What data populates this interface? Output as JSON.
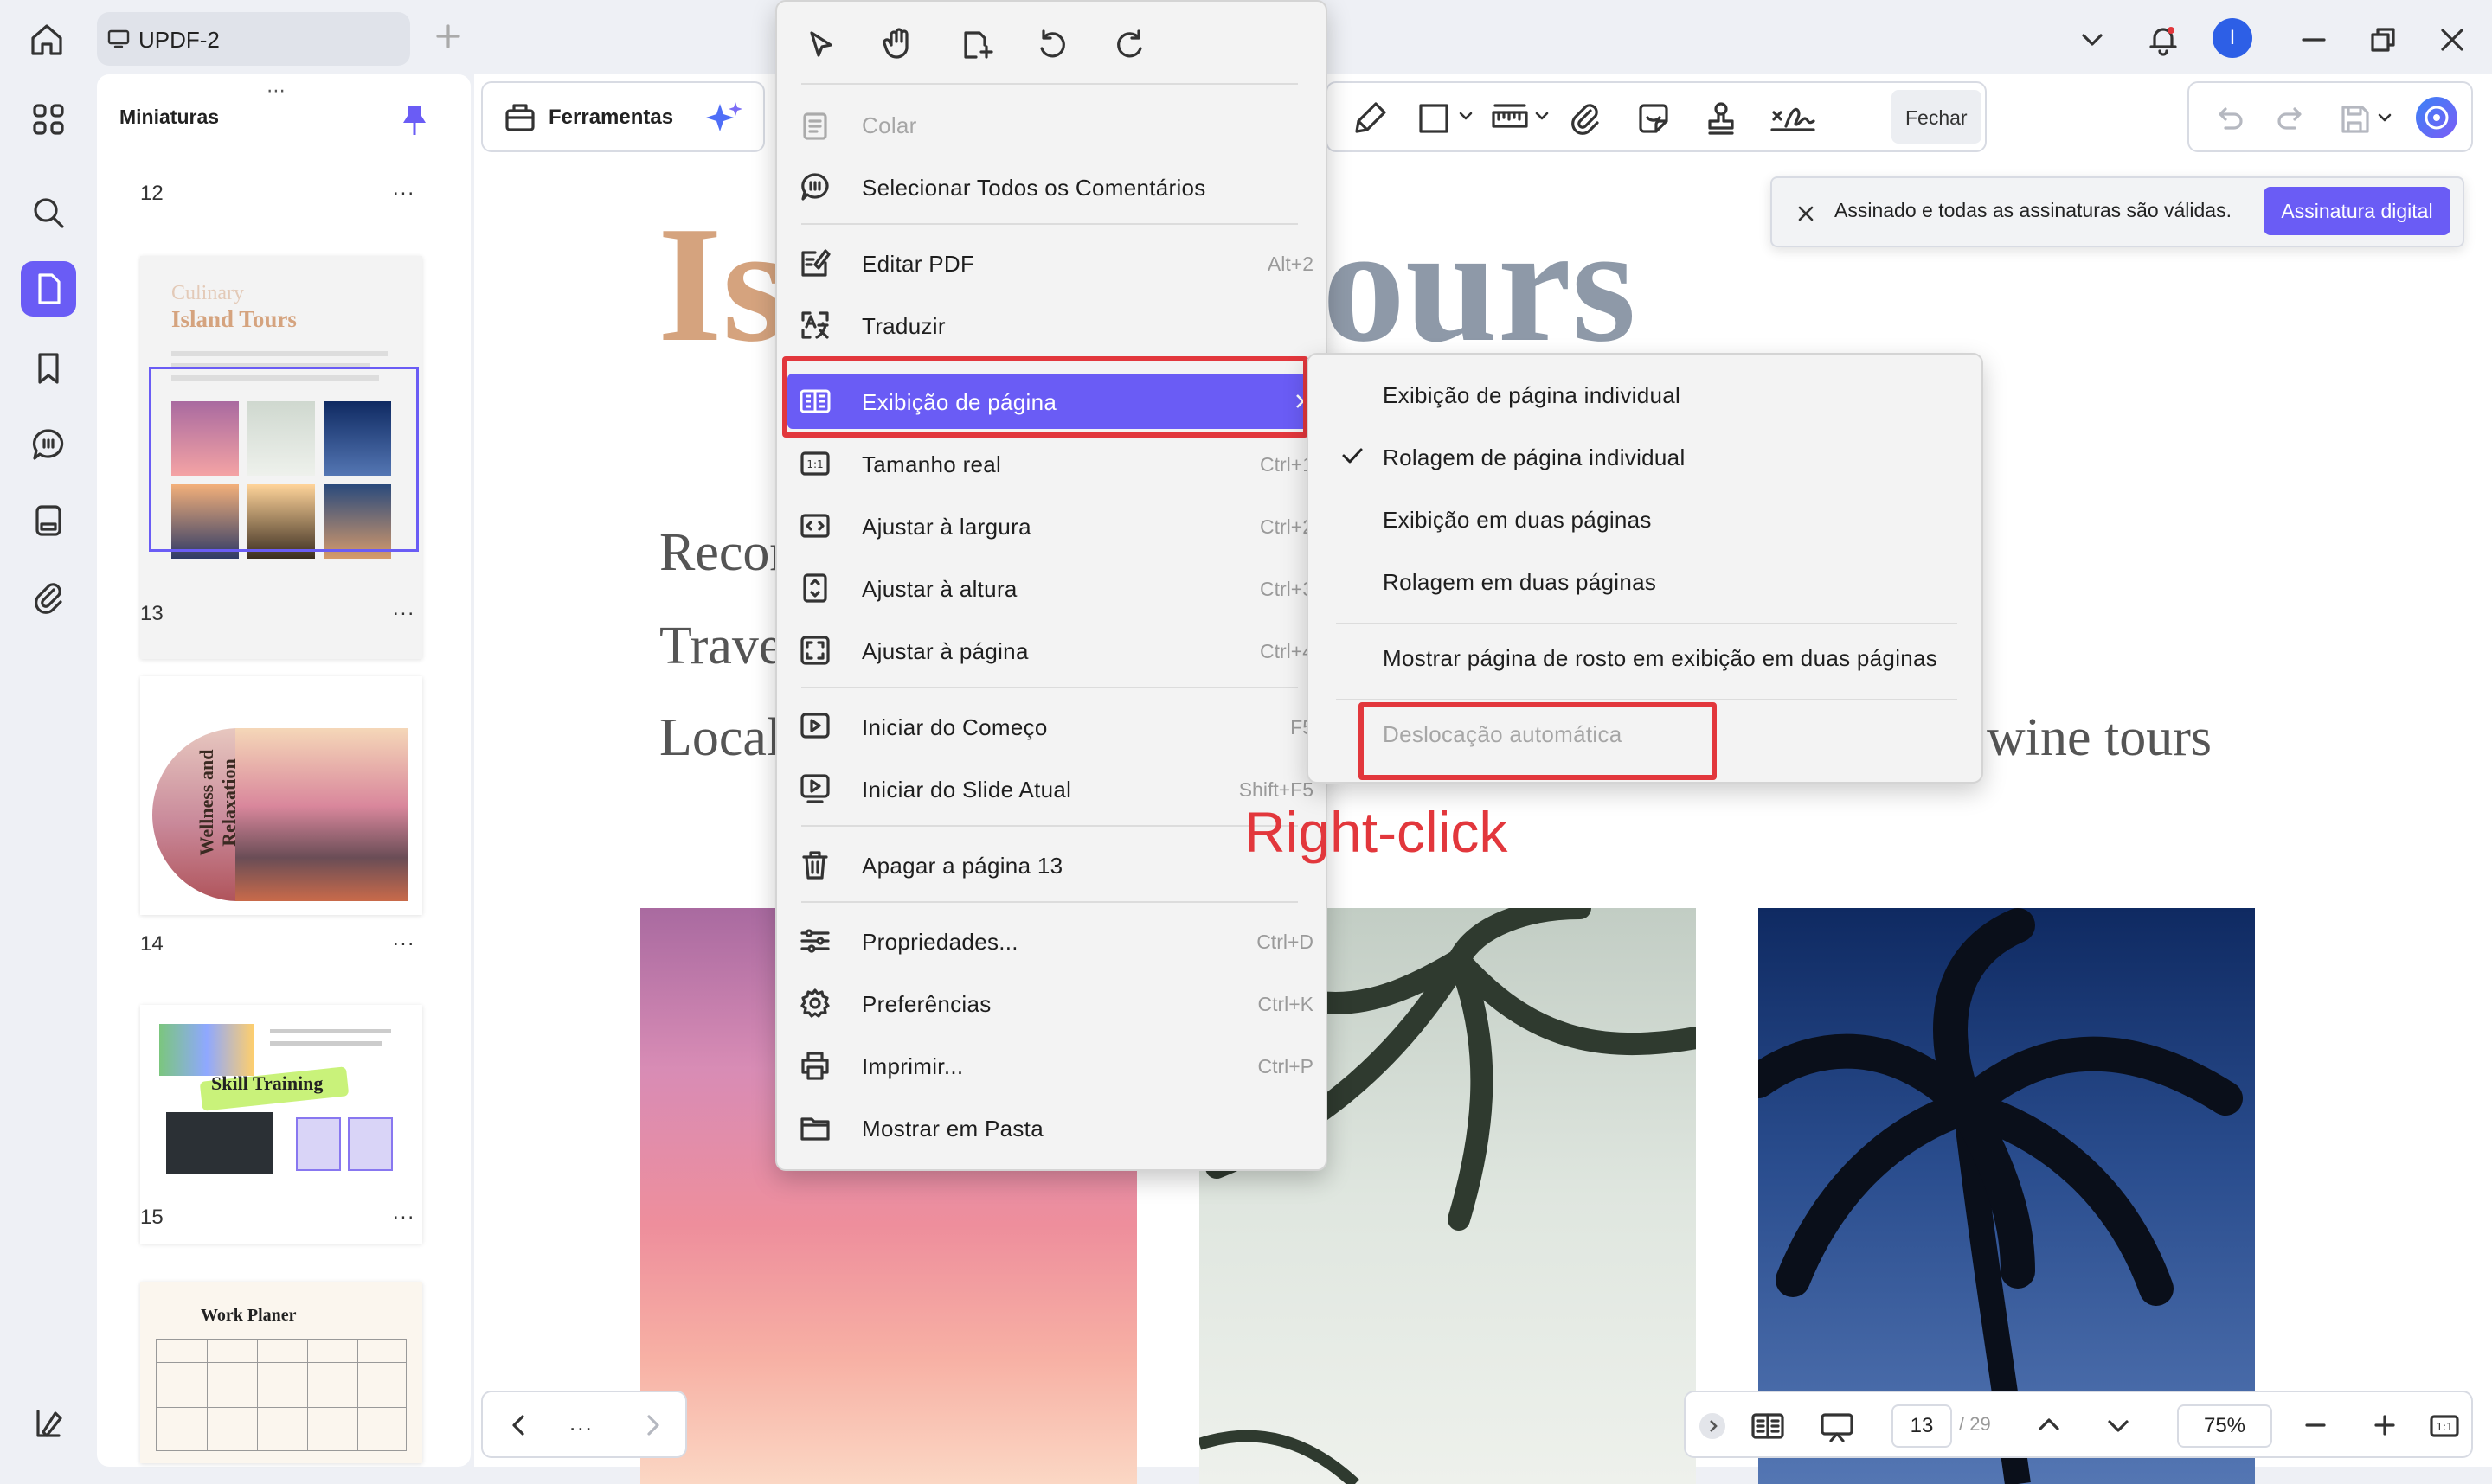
{
  "window": {
    "doc_tab_title": "UPDF-2"
  },
  "thumbnails": {
    "title": "Miniaturas",
    "more": "...",
    "pages": [
      {
        "number": "12"
      },
      {
        "number": "13",
        "preview_title_1": "Culinary",
        "preview_title_2": "Island Tours"
      },
      {
        "number": "14",
        "preview_text": "Wellness and Relaxation"
      },
      {
        "number": "15",
        "preview_text": "Skill Training"
      },
      {
        "preview_text": "Work Planer"
      }
    ]
  },
  "toolbar": {
    "tools_label": "Ferramentas",
    "close_label": "Fechar"
  },
  "signature_banner": {
    "message": "Assinado e todas as assinaturas são válidas.",
    "button": "Assinatura digital"
  },
  "document": {
    "title_left": "Is",
    "title_right": "ours",
    "lines": [
      "Recor",
      "Trave",
      "Local"
    ],
    "line_tail": "wine tours"
  },
  "context_menu": {
    "items": [
      {
        "label": "Colar",
        "shortcut": "",
        "icon": "paste-icon",
        "disabled": true
      },
      {
        "label": "Selecionar Todos os Comentários",
        "shortcut": "",
        "icon": "comments-icon"
      },
      {
        "label": "Editar PDF",
        "shortcut": "Alt+2",
        "icon": "edit-pdf-icon"
      },
      {
        "label": "Traduzir",
        "shortcut": "",
        "icon": "translate-icon"
      },
      {
        "label": "Exibição de página",
        "shortcut": "",
        "icon": "page-display-icon",
        "submenu": true
      },
      {
        "label": "Tamanho real",
        "shortcut": "Ctrl+1",
        "icon": "actual-size-icon"
      },
      {
        "label": "Ajustar à largura",
        "shortcut": "Ctrl+2",
        "icon": "fit-width-icon"
      },
      {
        "label": "Ajustar à altura",
        "shortcut": "Ctrl+3",
        "icon": "fit-height-icon"
      },
      {
        "label": "Ajustar à página",
        "shortcut": "Ctrl+4",
        "icon": "fit-page-icon"
      },
      {
        "label": "Iniciar do Começo",
        "shortcut": "F5",
        "icon": "play-start-icon"
      },
      {
        "label": "Iniciar do Slide Atual",
        "shortcut": "Shift+F5",
        "icon": "play-current-icon"
      },
      {
        "label": "Apagar a página 13",
        "shortcut": "",
        "icon": "trash-icon"
      },
      {
        "label": "Propriedades...",
        "shortcut": "Ctrl+D",
        "icon": "properties-icon"
      },
      {
        "label": "Preferências",
        "shortcut": "Ctrl+K",
        "icon": "gear-icon"
      },
      {
        "label": "Imprimir...",
        "shortcut": "Ctrl+P",
        "icon": "printer-icon"
      },
      {
        "label": "Mostrar em Pasta",
        "shortcut": "",
        "icon": "folder-icon"
      }
    ]
  },
  "page_display_submenu": {
    "items": [
      {
        "label": "Exibição de página individual",
        "checked": false
      },
      {
        "label": "Rolagem de página individual",
        "checked": true
      },
      {
        "label": "Exibição em duas páginas",
        "checked": false
      },
      {
        "label": "Rolagem em duas páginas",
        "checked": false
      },
      {
        "label": "Mostrar página de rosto em exibição em duas páginas",
        "checked": false
      },
      {
        "label": "Deslocação automática",
        "checked": false,
        "disabled": true
      }
    ]
  },
  "annotation_label": "Right-click",
  "page_nav": {
    "current_page": "13",
    "total": "/ 29",
    "zoom": "75%",
    "more": "..."
  },
  "colors": {
    "accent": "#6a5cf5",
    "highlight": "#e2373c",
    "avatar": "#2d5fe6"
  },
  "avatar_initial": "I"
}
